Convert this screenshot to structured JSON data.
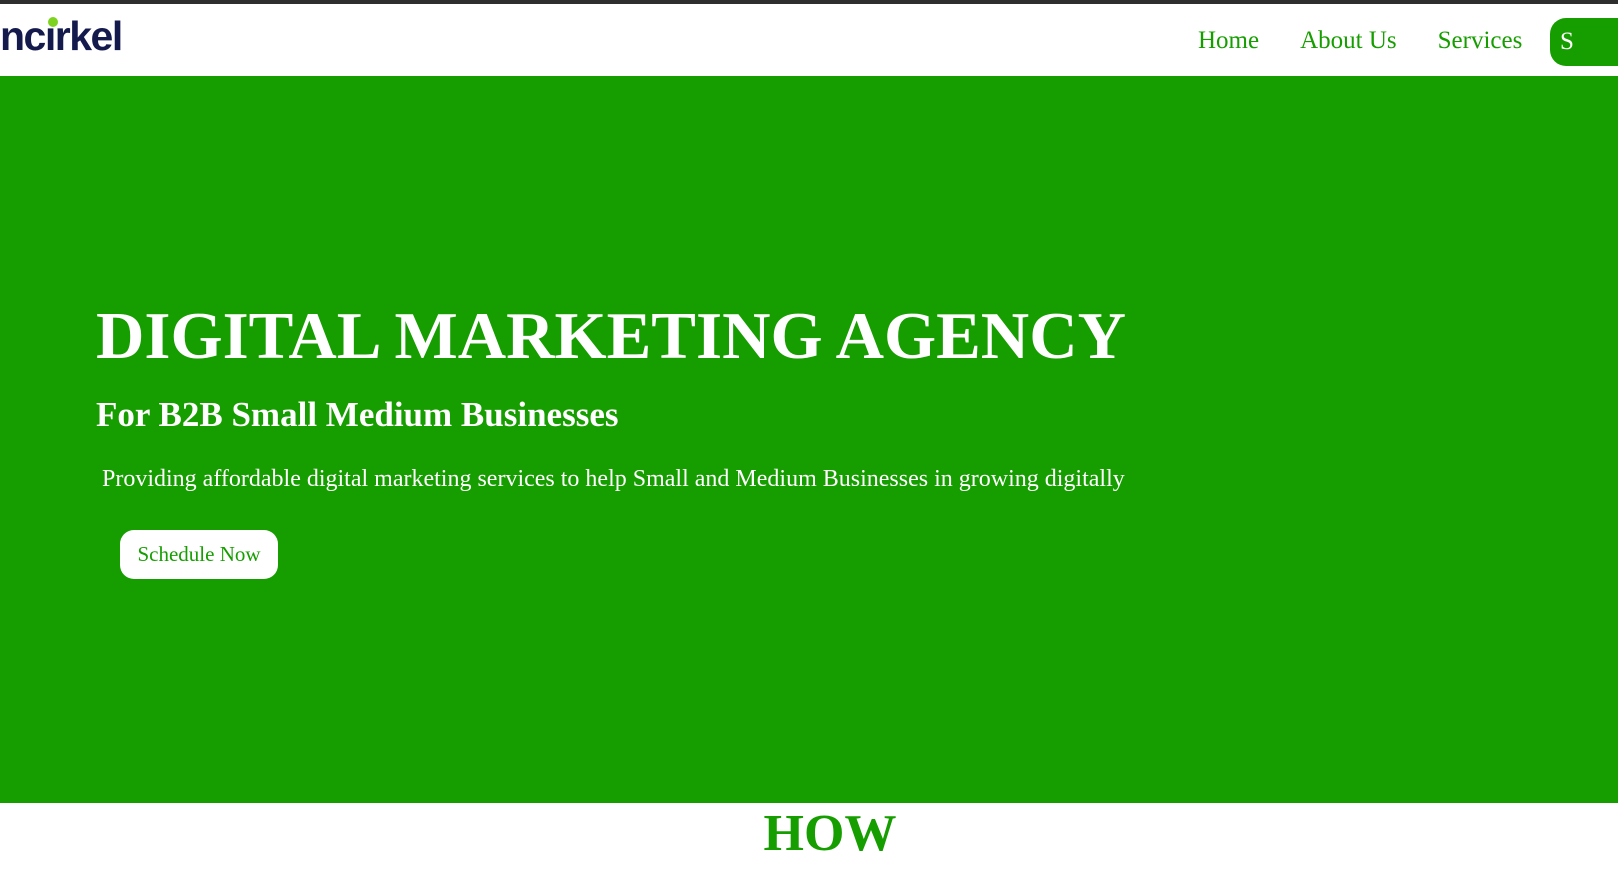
{
  "header": {
    "logo_text": "ncirkel",
    "nav": {
      "home": "Home",
      "about": "About Us",
      "services": "Services",
      "cta_partial": "S"
    }
  },
  "hero": {
    "title": "DIGITAL MARKETING AGENCY",
    "subtitle": "For B2B Small Medium Businesses",
    "description": "Providing affordable digital marketing services to help Small and Medium Businesses in growing digitally",
    "button_label": "Schedule Now"
  },
  "section": {
    "heading_partial": "HOW"
  },
  "colors": {
    "brand_green": "#169e00",
    "logo_navy": "#151a4d",
    "logo_dot": "#7ed321",
    "text_white": "#ffffff",
    "top_bar": "#2e2e2e"
  },
  "icons": {
    "logo_dot": "green-circle-dot"
  }
}
